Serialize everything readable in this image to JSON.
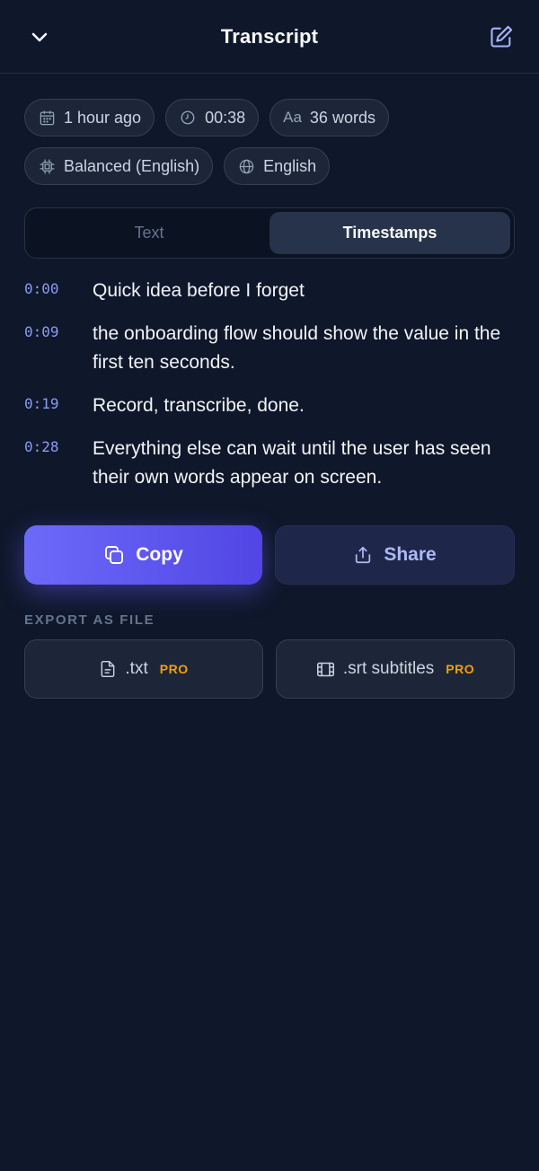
{
  "header": {
    "title": "Transcript",
    "back_icon": "chevron-down-icon",
    "edit_icon": "edit-icon"
  },
  "meta_chips": [
    {
      "icon": "calendar-icon",
      "label": "1 hour ago"
    },
    {
      "icon": "clock-icon",
      "label": "00:38"
    },
    {
      "icon": "text-size-icon",
      "icon_text": "Aa",
      "label": "36 words"
    },
    {
      "icon": "chip-icon",
      "label": "Balanced (English)"
    },
    {
      "icon": "globe-icon",
      "label": "English"
    }
  ],
  "tabs": [
    {
      "label": "Text",
      "active": false
    },
    {
      "label": "Timestamps",
      "active": true
    }
  ],
  "segments": [
    {
      "time": "0:00",
      "text": "Quick idea before I forget"
    },
    {
      "time": "0:09",
      "text": "the onboarding flow should show the value in the first ten seconds."
    },
    {
      "time": "0:19",
      "text": "Record, transcribe, done."
    },
    {
      "time": "0:28",
      "text": "Everything else can wait until the user has seen their own words appear on screen."
    }
  ],
  "actions": {
    "copy_label": "Copy",
    "share_label": "Share"
  },
  "export": {
    "label": "EXPORT AS FILE",
    "txt_label": ".txt",
    "srt_label": ".srt subtitles",
    "pro_badge": "PRO"
  },
  "colors": {
    "background": "#0f172a",
    "accent": "#5b57f0",
    "timestamp": "#8b9cf4",
    "pro": "#f59e0b"
  }
}
